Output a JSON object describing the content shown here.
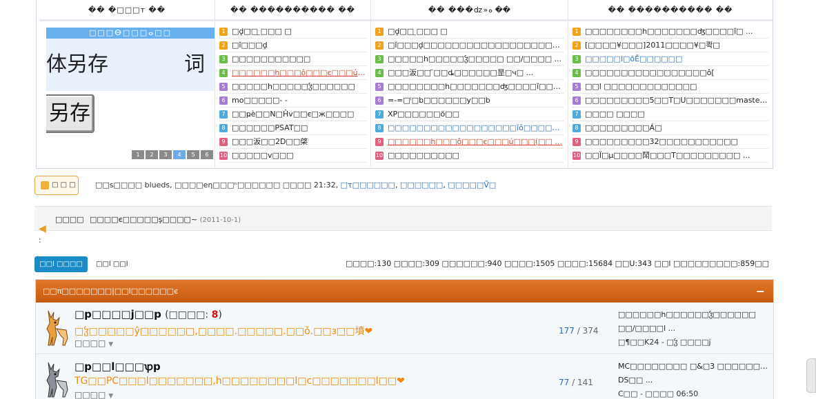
{
  "portal": {
    "columns": [
      {
        "title": "�� �□□□т ��"
      },
      {
        "title": "�� ���������� ��"
      },
      {
        "title": "�� ���ǳ»ه ��"
      },
      {
        "title": "�� ���������� ��"
      }
    ],
    "slideshow": {
      "bar_text": "□□□ⴱ□□□ⴰ□□",
      "big_text_1": "体另存",
      "big_text_2": "词",
      "button_text": "另存",
      "pages": [
        "1",
        "2",
        "3",
        "4",
        "5",
        "6"
      ],
      "active_page": "4"
    },
    "lists": [
      {
        "items": [
          {
            "n": "1",
            "text": "□ḓ□□ ̤□□□ □",
            "style": ""
          },
          {
            "n": "2",
            "text": "□ǐ□□□ḓ",
            "style": ""
          },
          {
            "n": "3",
            "text": "□□□□□□□□□□□",
            "style": ""
          },
          {
            "n": "4",
            "text": "□□□□□□h□□□ô□□□є□□□ú□□□",
            "style": "red"
          },
          {
            "n": "5",
            "text": "□□□□□h□□□□□ჴ□□□□□□",
            "style": ""
          },
          {
            "n": "6",
            "text": "mo□□□□□- -",
            "style": ""
          },
          {
            "n": "7",
            "text": "□□ҏè□□N□Ĥv□□є□ж□□□□",
            "style": ""
          },
          {
            "n": "8",
            "text": "□□□□□□PSAT□□",
            "style": ""
          },
          {
            "n": "9",
            "text": "□□□汳□□2D□□棨",
            "style": ""
          },
          {
            "n": "10",
            "text": "□□□□□v□□□",
            "style": ""
          }
        ]
      },
      {
        "items": [
          {
            "n": "1",
            "text": "□ḓ□□ ̤□□□ □",
            "style": ""
          },
          {
            "n": "2",
            "text": "□ǐ□□□ḓ□□□□□□□□□□□□□□□□□□ጎ□□ ...",
            "style": ""
          },
          {
            "n": "3",
            "text": "□□□□□h□□□□□ჴ□□□□□ □□/□□□□ ...",
            "style": ""
          },
          {
            "n": "4",
            "text": "□□□汳□□ ̈□□ȡ□□□□□□昰□ч□ ...",
            "style": ""
          },
          {
            "n": "5",
            "text": "□□□□□□□□h□□□□□□□ʤ□□□□ǐ□□□ ...",
            "style": ""
          },
          {
            "n": "6",
            "text": "=-=□ⁱ□b□□□□□□у□□b",
            "style": ""
          },
          {
            "n": "7",
            "text": "XP□□□□□□ö□□",
            "style": ""
          },
          {
            "n": "8",
            "text": "□□□□□□□□□□□□□□□□□□ǐô□□□□PM ...",
            "style": "blue"
          },
          {
            "n": "9",
            "text": "□□□□□□h□□□ô□□□є□□□ú□□□(□□ ...",
            "style": "red"
          },
          {
            "n": "10",
            "text": "□□□□□□□□□□",
            "style": ""
          }
        ]
      },
      {
        "items": [
          {
            "n": "1",
            "text": "□□□□□□□□h□□□□□□□ʤ□□□□ǐ□ ...",
            "style": ""
          },
          {
            "n": "2",
            "text": "[□□□□¥□□□]2011□□□□¥□콱□",
            "style": ""
          },
          {
            "n": "3",
            "text": "□□□□□l□ōĚ□□□□□□",
            "style": "blue"
          },
          {
            "n": "4",
            "text": "□□□□□□□□□□□□□□□□□ô[",
            "style": ""
          },
          {
            "n": "5",
            "text": "□□l □□□□□□□□□□□□□",
            "style": ""
          },
          {
            "n": "6",
            "text": "□□□□□□□□□5□□T□U□□□□□□□maste ...",
            "style": ""
          },
          {
            "n": "7",
            "text": "□□□□ □□□□",
            "style": ""
          },
          {
            "n": "8",
            "text": "□□□□□□□□□Á□",
            "style": ""
          },
          {
            "n": "9",
            "text": "□□□□□□□□□32□□□□□□□□□□□",
            "style": ""
          },
          {
            "n": "10",
            "text": "□□Ï□μ□□□□鬦□□□T□□□□□□□□□ ...",
            "style": ""
          }
        ]
      }
    ]
  },
  "members": {
    "button_label": "□ □ □",
    "online_text": "□□s□□□□ blueds, □□□□eη□□□ⁿ□□□□□□ □□□□ 21:32,",
    "links": [
      "□τ□□□□□□",
      "□□□□□□",
      "□□□□□Ṽ□"
    ]
  },
  "announcement": {
    "label": "□□□□",
    "text": "□□□□є□□□□□ş□□□□~",
    "date": "(2011-10-1)",
    "colon": ":"
  },
  "tabs": {
    "active": "□□l □□□□",
    "other": "□□l □□l"
  },
  "stats": "□□□□:130  □□□□:309  □□□□□□:940  □□□□:1505  □□□□:15684  □□U:343  □□l □□□□□□□□□:859□□",
  "forum": {
    "header": "□□π□□□□□□□|□□l□□□□□□є",
    "collapse": "−",
    "rows": [
      {
        "title": "□p□□□□j□□p",
        "today_prefix": "(□□□□: ",
        "today_count": "8",
        "today_suffix": ")",
        "desc": "□ჴ□□□□□ŷ□□□□□□,□□□□.□□□□□.□□ǒ.□□ɜ□□墳❤",
        "mods": "□□□□",
        "threads": "177",
        "posts": "374",
        "last1": "□□□□□□h□□□□□□ჴ□□□□□□",
        "last2": "□□/□□□□l ...",
        "last3": "□¶□□K24 - □ჴ □□□□j"
      },
      {
        "title": "□p□□l□□□ꝕp",
        "today_prefix": "",
        "today_count": "",
        "today_suffix": "",
        "desc": "TG□□PC□□□l□□□□□□□,h□□□□□□□□l□c□□□□□□□l□□❤",
        "mods": "□□□□",
        "threads": "77",
        "posts": "141",
        "last1": "MC□□□□□□□□ □&□3 □□□□□□□□□□ჴ",
        "last2": "DS□□ ...",
        "last3": "C□□ - □□□□ 06:50"
      }
    ]
  },
  "colors": {
    "forum_header": "#d2691a",
    "tab_active": "#1a8bc6",
    "link": "#2d6db5",
    "desc": "#ee8a12"
  }
}
